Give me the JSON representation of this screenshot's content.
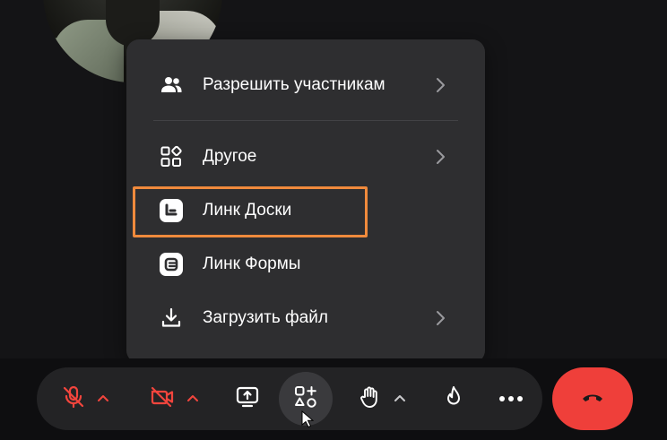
{
  "menu": {
    "items": [
      {
        "label": "Разрешить участникам",
        "icon": "participants-icon",
        "has_submenu": true
      },
      {
        "label": "Другое",
        "icon": "apps-icon",
        "has_submenu": true
      },
      {
        "label": "Линк Доски",
        "icon": "link-board-icon",
        "has_submenu": false,
        "highlighted": true
      },
      {
        "label": "Линк Формы",
        "icon": "link-form-icon",
        "has_submenu": false
      },
      {
        "label": "Загрузить файл",
        "icon": "download-icon",
        "has_submenu": true
      }
    ]
  },
  "controls": [
    {
      "name": "microphone-muted-icon",
      "state": "off"
    },
    {
      "name": "camera-off-icon",
      "state": "off"
    },
    {
      "name": "screen-share-icon"
    },
    {
      "name": "apps-add-icon",
      "state": "active"
    },
    {
      "name": "raise-hand-icon"
    },
    {
      "name": "reactions-icon"
    },
    {
      "name": "more-icon"
    },
    {
      "name": "end-call-icon"
    }
  ],
  "colors": {
    "background": "#141416",
    "menu_bg": "#2e2e30",
    "highlight_border": "#f08a3c",
    "muted_red": "#f2453d",
    "end_call": "#ef3f3a"
  }
}
